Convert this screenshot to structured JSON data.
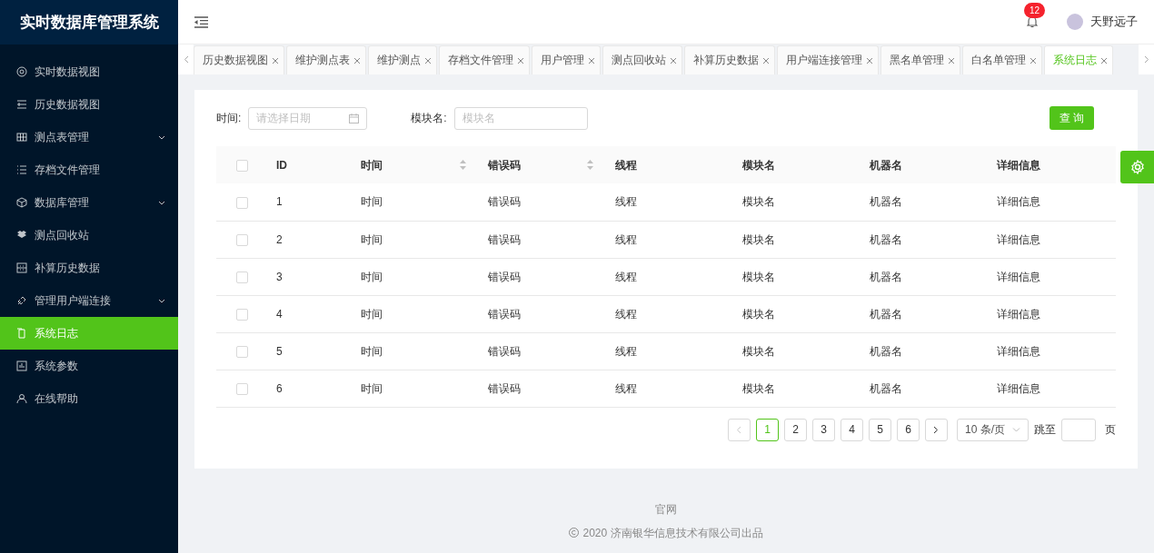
{
  "sidebar": {
    "title": "实时数据库管理系统",
    "items": [
      {
        "label": "实时数据视图",
        "has_submenu": false,
        "selected": false
      },
      {
        "label": "历史数据视图",
        "has_submenu": false,
        "selected": false
      },
      {
        "label": "测点表管理",
        "has_submenu": true,
        "selected": false
      },
      {
        "label": "存档文件管理",
        "has_submenu": false,
        "selected": false
      },
      {
        "label": "数据库管理",
        "has_submenu": true,
        "selected": false
      },
      {
        "label": "测点回收站",
        "has_submenu": false,
        "selected": false
      },
      {
        "label": "补算历史数据",
        "has_submenu": false,
        "selected": false
      },
      {
        "label": "管理用户端连接",
        "has_submenu": true,
        "selected": false
      },
      {
        "label": "系统日志",
        "has_submenu": false,
        "selected": true
      },
      {
        "label": "系统参数",
        "has_submenu": false,
        "selected": false
      },
      {
        "label": "在线帮助",
        "has_submenu": false,
        "selected": false
      }
    ]
  },
  "header": {
    "notification_count": "12",
    "user_name": "天野远子"
  },
  "tabs": [
    {
      "label": "历史数据视图",
      "selected": false
    },
    {
      "label": "维护测点表",
      "selected": false
    },
    {
      "label": "维护测点",
      "selected": false
    },
    {
      "label": "存档文件管理",
      "selected": false
    },
    {
      "label": "用户管理",
      "selected": false
    },
    {
      "label": "测点回收站",
      "selected": false
    },
    {
      "label": "补算历史数据",
      "selected": false
    },
    {
      "label": "用户端连接管理",
      "selected": false
    },
    {
      "label": "黑名单管理",
      "selected": false
    },
    {
      "label": "白名单管理",
      "selected": false
    },
    {
      "label": "系统日志",
      "selected": true
    }
  ],
  "filters": {
    "time_label": "时间:",
    "time_placeholder": "请选择日期",
    "module_label": "模块名:",
    "module_placeholder": "模块名",
    "search_button": "查 询"
  },
  "table": {
    "header_checked": false,
    "columns": [
      {
        "label": "ID",
        "sortable": false
      },
      {
        "label": "时间",
        "sortable": true
      },
      {
        "label": "错误码",
        "sortable": true
      },
      {
        "label": "线程",
        "sortable": false
      },
      {
        "label": "模块名",
        "sortable": false
      },
      {
        "label": "机器名",
        "sortable": false
      },
      {
        "label": "详细信息",
        "sortable": false
      }
    ],
    "rows": [
      {
        "checked": false,
        "cells": [
          "1",
          "时间",
          "错误码",
          "线程",
          "模块名",
          "机器名",
          "详细信息"
        ]
      },
      {
        "checked": false,
        "cells": [
          "2",
          "时间",
          "错误码",
          "线程",
          "模块名",
          "机器名",
          "详细信息"
        ]
      },
      {
        "checked": false,
        "cells": [
          "3",
          "时间",
          "错误码",
          "线程",
          "模块名",
          "机器名",
          "详细信息"
        ]
      },
      {
        "checked": false,
        "cells": [
          "4",
          "时间",
          "错误码",
          "线程",
          "模块名",
          "机器名",
          "详细信息"
        ]
      },
      {
        "checked": false,
        "cells": [
          "5",
          "时间",
          "错误码",
          "线程",
          "模块名",
          "机器名",
          "详细信息"
        ]
      },
      {
        "checked": false,
        "cells": [
          "6",
          "时间",
          "错误码",
          "线程",
          "模块名",
          "机器名",
          "详细信息"
        ]
      }
    ]
  },
  "pagination": {
    "prev_disabled": true,
    "next_disabled": false,
    "pages": [
      {
        "label": "1",
        "selected": true
      },
      {
        "label": "2",
        "selected": false
      },
      {
        "label": "3",
        "selected": false
      },
      {
        "label": "4",
        "selected": false
      },
      {
        "label": "5",
        "selected": false
      },
      {
        "label": "6",
        "selected": false
      }
    ],
    "page_size": "10 条/页",
    "jump_label": "跳至",
    "page_suffix": "页"
  },
  "footer": {
    "link": "官网",
    "copyright": "2020 济南银华信息技术有限公司出品"
  }
}
